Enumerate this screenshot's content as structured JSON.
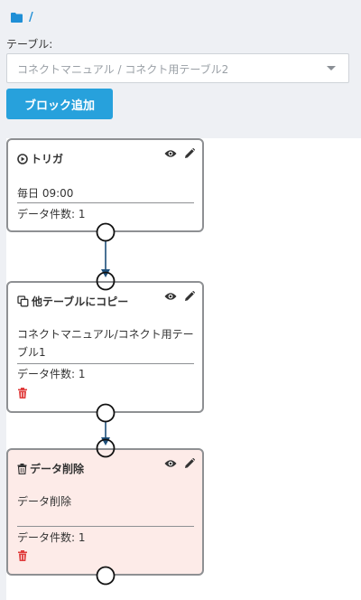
{
  "breadcrumb": {
    "folder_icon": "folder-icon",
    "separator": "/"
  },
  "table_selector": {
    "label": "テーブル:",
    "selected_value": "コネクトマニュアル / コネクト用テーブル2"
  },
  "toolbar": {
    "add_block_label": "ブロック追加"
  },
  "blocks": [
    {
      "title": "トリガ",
      "title_icon": "play-circle-icon",
      "field": "毎日 09:00",
      "count_label": "データ件数: 1"
    },
    {
      "title": "他テーブルにコピー",
      "title_icon": "copy-icon",
      "field": "コネクトマニュアル/コネクト用テーブル1",
      "count_label": "データ件数: 1"
    },
    {
      "title": "データ削除",
      "title_icon": "trash-icon",
      "field": "データ削除",
      "count_label": "データ件数: 1"
    }
  ],
  "colors": {
    "accent": "#27a1dc",
    "panel_bg": "#eef0f4",
    "delete_block_bg": "#fdebe8",
    "delete_icon": "#e03c3c",
    "connector": "#1d4f7a"
  }
}
